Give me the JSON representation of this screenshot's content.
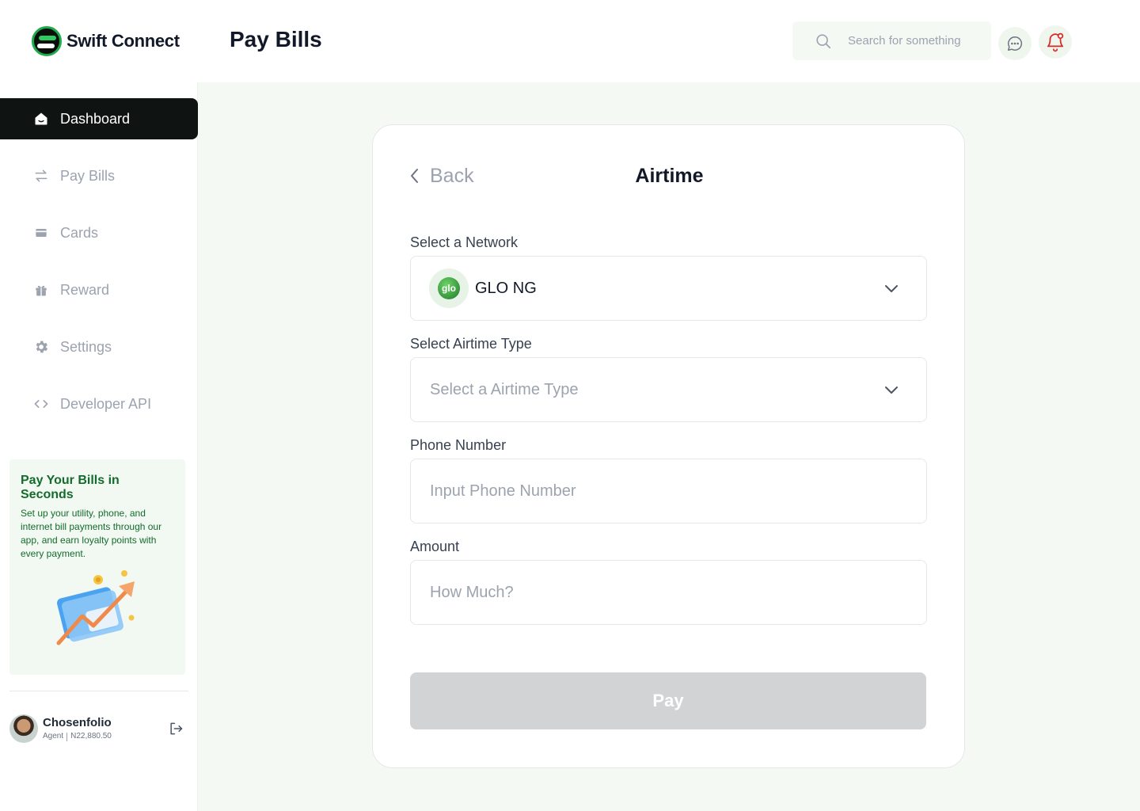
{
  "app": {
    "name": "Swift Connect",
    "page_title": "Pay Bills"
  },
  "header": {
    "search_placeholder": "Search for something",
    "icons": [
      "search-icon",
      "chat-icon",
      "bell-icon"
    ],
    "notification_color": "#dc2626"
  },
  "sidebar": {
    "items": [
      {
        "label": "Dashboard",
        "icon": "home-icon",
        "active": true
      },
      {
        "label": "Pay Bills",
        "icon": "transfer-icon",
        "active": false
      },
      {
        "label": "Cards",
        "icon": "card-icon",
        "active": false
      },
      {
        "label": "Reward",
        "icon": "gift-icon",
        "active": false
      },
      {
        "label": "Settings",
        "icon": "gear-icon",
        "active": false
      },
      {
        "label": "Developer API",
        "icon": "code-icon",
        "active": false
      }
    ],
    "promo": {
      "title": "Pay Your Bills in Seconds",
      "text": "Set up your utility, phone, and internet bill payments through our app, and earn loyalty points with every payment."
    },
    "profile": {
      "name": "Chosenfolio",
      "role": "Agent",
      "balance": "N22,880.50"
    }
  },
  "form": {
    "back_label": "Back",
    "title": "Airtime",
    "network": {
      "label": "Select a Network",
      "value": "GLO NG",
      "badge": "glo"
    },
    "airtime_type": {
      "label": "Select Airtime Type",
      "placeholder": "Select a Airtime Type"
    },
    "phone": {
      "label": "Phone Number",
      "placeholder": "Input Phone Number"
    },
    "amount": {
      "label": "Amount",
      "placeholder": "How Much?"
    },
    "pay_label": "Pay"
  },
  "colors": {
    "brand_green": "#146b2c",
    "accent_green": "#1faa4b",
    "active_nav": "#0f1412",
    "page_bg": "#f4f9f4",
    "disabled_button": "#d1d3d5"
  }
}
